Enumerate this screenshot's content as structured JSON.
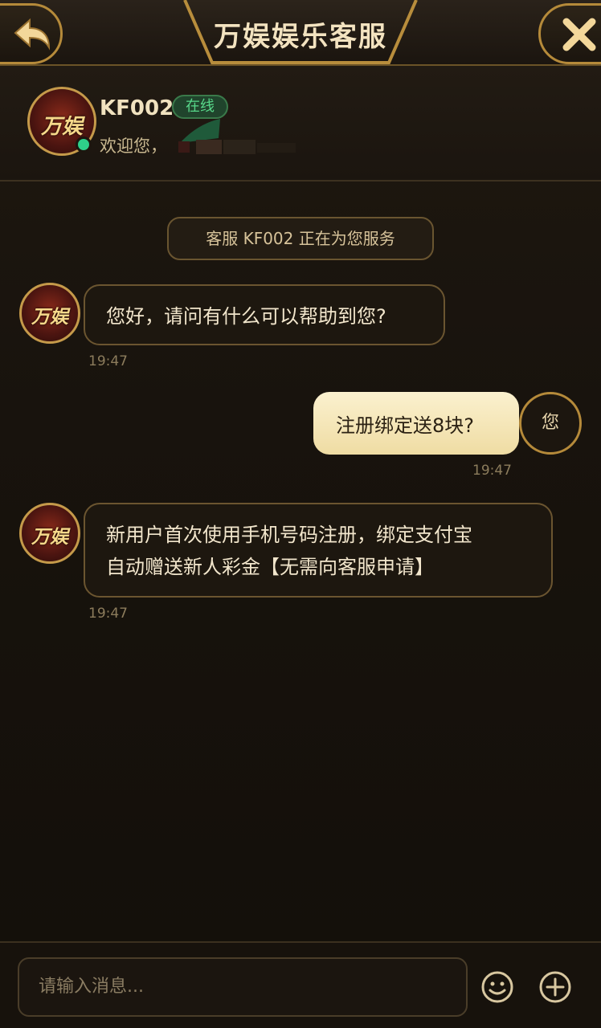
{
  "header": {
    "title": "万娱娱乐客服",
    "back_icon": "back-arrow-icon",
    "close_icon": "close-icon"
  },
  "agent": {
    "logo_text": "万娱",
    "name": "KF002",
    "status": "在线",
    "welcome": "欢迎您，"
  },
  "chat": {
    "system_message": "客服 KF002 正在为您服务",
    "messages": [
      {
        "from": "agent",
        "text": "您好，请问有什么可以帮助到您?",
        "time": "19:47"
      },
      {
        "from": "user",
        "text": "注册绑定送8块?",
        "time": "19:47",
        "avatar_label": "您"
      },
      {
        "from": "agent",
        "text_line1": "新用户首次使用手机号码注册，绑定支付宝",
        "text_line2": "自动赠送新人彩金【无需向客服申请】",
        "time": "19:47"
      }
    ]
  },
  "composer": {
    "placeholder": "请输入消息...",
    "emoji_icon": "emoji-icon",
    "add_icon": "plus-circle-icon"
  },
  "colors": {
    "gold": "#c59a4a",
    "online_green": "#2ed08a",
    "bubble_out": "#f5e6b5"
  }
}
